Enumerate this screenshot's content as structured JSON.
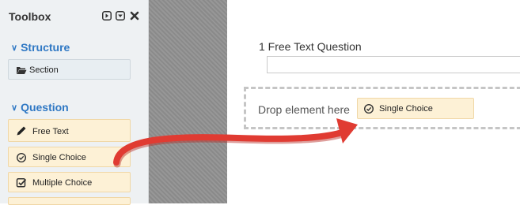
{
  "toolbox": {
    "title": "Toolbox",
    "controls": [
      "expand-icon",
      "collapse-icon",
      "close-icon"
    ],
    "sections": [
      {
        "label": "Structure",
        "items": [
          {
            "label": "Section",
            "icon": "folder-open-icon"
          }
        ]
      },
      {
        "label": "Question",
        "items": [
          {
            "label": "Free Text",
            "icon": "pencil-icon"
          },
          {
            "label": "Single Choice",
            "icon": "check-circle-icon"
          },
          {
            "label": "Multiple Choice",
            "icon": "check-square-icon"
          }
        ]
      }
    ]
  },
  "canvas": {
    "question": {
      "title": "1 Free Text Question",
      "value": ""
    },
    "dropzone": {
      "text": "Drop element here",
      "dragged": {
        "label": "Single Choice",
        "icon": "check-circle-icon"
      }
    }
  },
  "colors": {
    "accent": "#2f78c4",
    "tool_bg": "#fdf1d6",
    "arrow": "#e03b32",
    "panel_bg": "#eef1f3"
  }
}
